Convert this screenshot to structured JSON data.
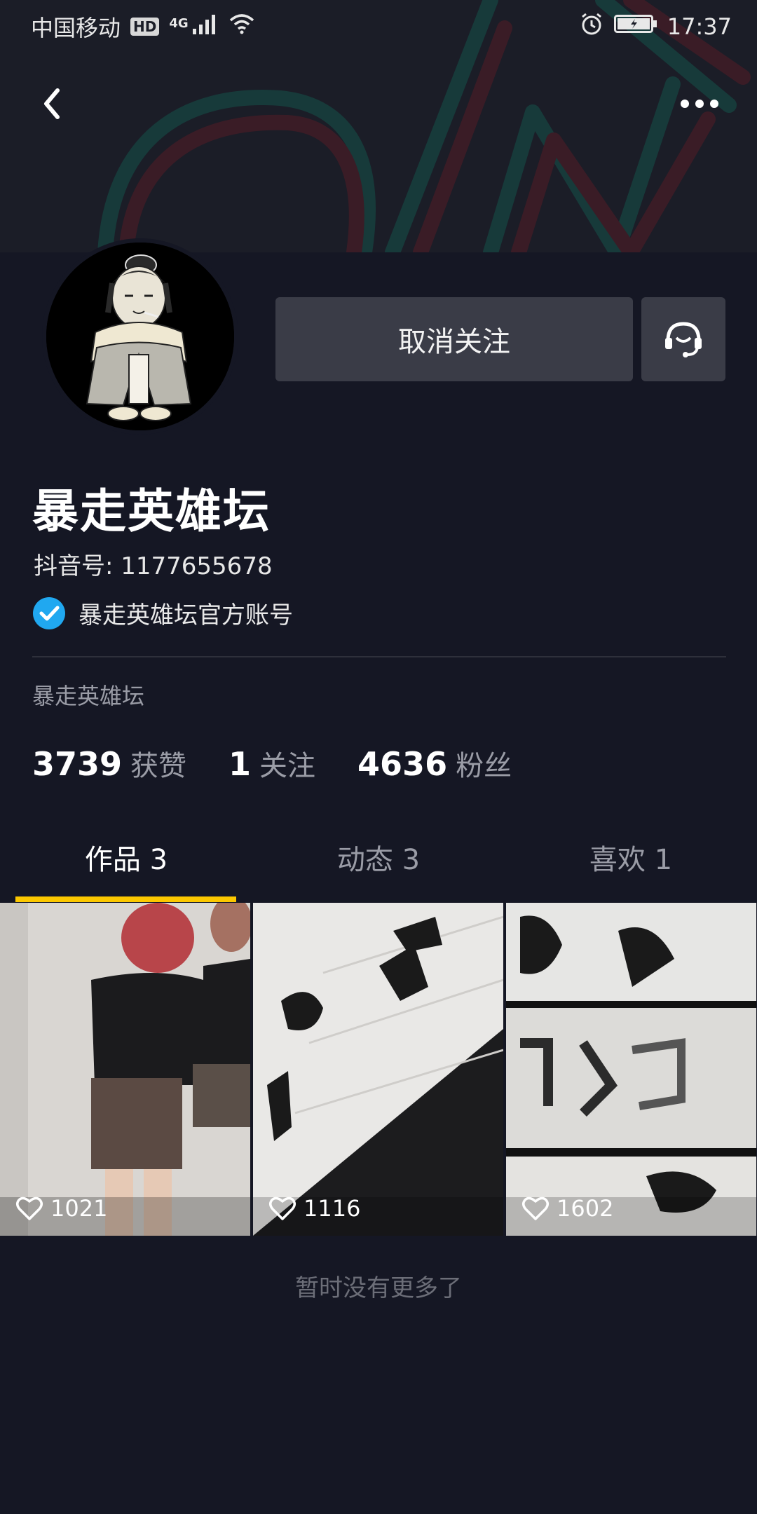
{
  "status_bar": {
    "carrier": "中国移动",
    "hd_badge": "HD",
    "network": "4G",
    "time": "17:37"
  },
  "header": {
    "back_icon": "back-arrow-icon",
    "more_icon": "more-dots-icon"
  },
  "profile": {
    "follow_button_label": "取消关注",
    "service_icon": "headset-icon",
    "name": "暴走英雄坛",
    "douyin_id": "抖音号: 1177655678",
    "verified_label": "暴走英雄坛官方账号",
    "bio": "暴走英雄坛",
    "stats": [
      {
        "num": "3739",
        "label": "获赞"
      },
      {
        "num": "1",
        "label": "关注"
      },
      {
        "num": "4636",
        "label": "粉丝"
      }
    ]
  },
  "tabs": [
    {
      "label": "作品 3",
      "active": true
    },
    {
      "label": "动态 3",
      "active": false
    },
    {
      "label": "喜欢 1",
      "active": false
    }
  ],
  "videos": [
    {
      "likes": "1021"
    },
    {
      "likes": "1116"
    },
    {
      "likes": "1602"
    }
  ],
  "footer": {
    "no_more": "暂时没有更多了"
  },
  "colors": {
    "background": "#151724",
    "accent": "#fcc800",
    "verified_blue": "#20a8f0",
    "button_bg": "#3a3c47"
  }
}
